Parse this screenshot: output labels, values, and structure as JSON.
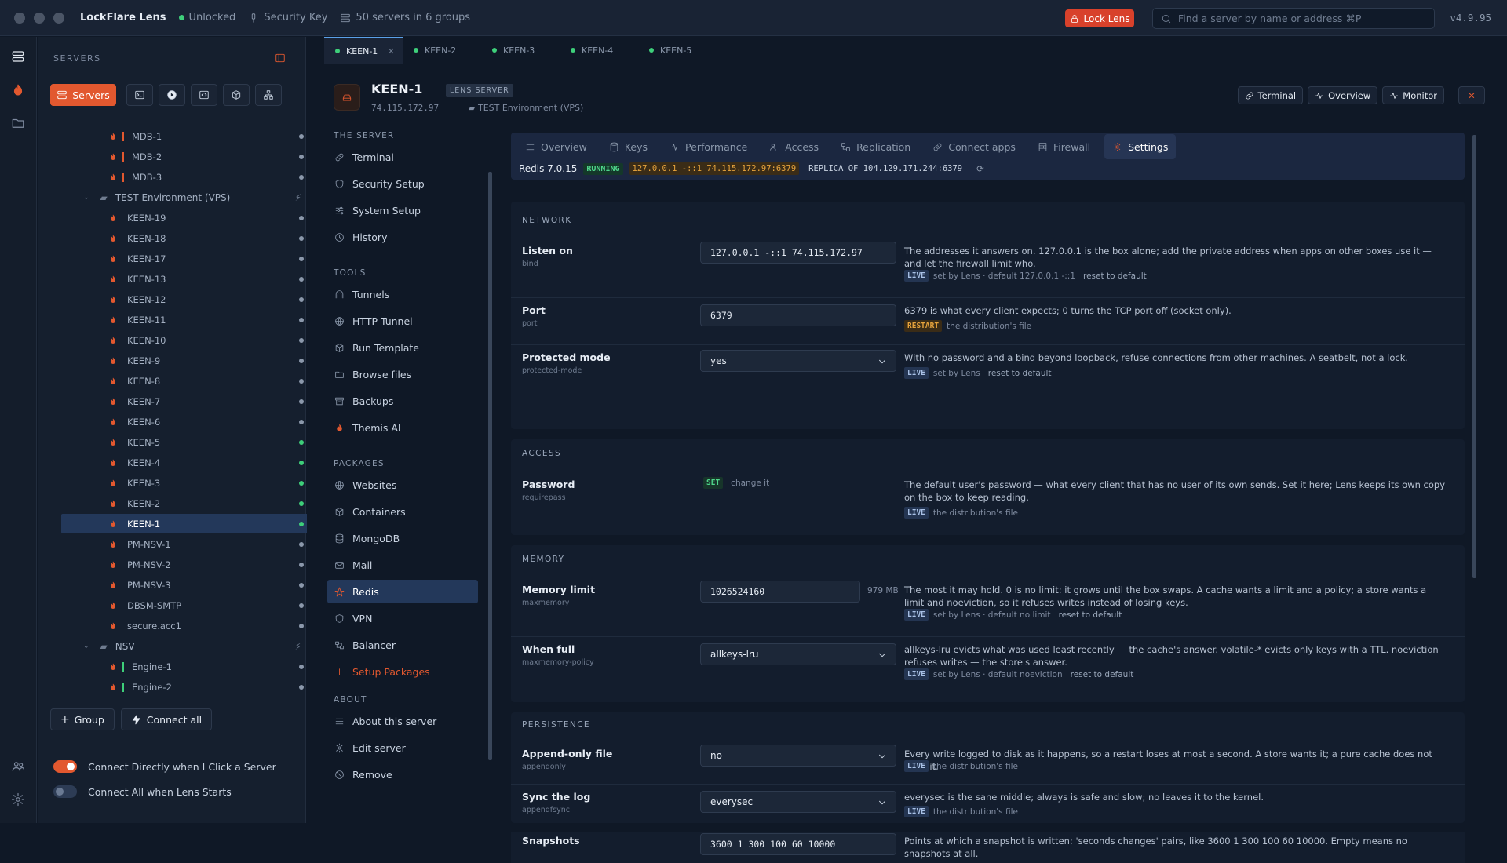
{
  "titlebar": {
    "app": "LockFlare Lens",
    "status": "Unlocked",
    "key": "Security Key",
    "servers": "50 servers in 6 groups",
    "lock": "Lock Lens",
    "search_placeholder": "Find a server by name or address ⌘P",
    "version": "v4.9.95"
  },
  "sidebar": {
    "title": "SERVERS",
    "servers_btn": "Servers",
    "tree": [
      {
        "kind": "server",
        "label": "MDB-1",
        "bar": "#e2582f",
        "dot": "#8b98ab"
      },
      {
        "kind": "server",
        "label": "MDB-2",
        "bar": "#e2582f",
        "dot": "#8b98ab"
      },
      {
        "kind": "server",
        "label": "MDB-3",
        "bar": "#e2582f",
        "dot": "#8b98ab"
      },
      {
        "kind": "group",
        "label": "TEST Environment (VPS)"
      },
      {
        "kind": "server",
        "label": "KEEN-19",
        "dot": "#8b98ab"
      },
      {
        "kind": "server",
        "label": "KEEN-18",
        "dot": "#8b98ab"
      },
      {
        "kind": "server",
        "label": "KEEN-17",
        "dot": "#8b98ab"
      },
      {
        "kind": "server",
        "label": "KEEN-13",
        "dot": "#8b98ab"
      },
      {
        "kind": "server",
        "label": "KEEN-12",
        "dot": "#8b98ab"
      },
      {
        "kind": "server",
        "label": "KEEN-11",
        "dot": "#8b98ab"
      },
      {
        "kind": "server",
        "label": "KEEN-10",
        "dot": "#8b98ab"
      },
      {
        "kind": "server",
        "label": "KEEN-9",
        "dot": "#8b98ab"
      },
      {
        "kind": "server",
        "label": "KEEN-8",
        "dot": "#8b98ab"
      },
      {
        "kind": "server",
        "label": "KEEN-7",
        "dot": "#8b98ab"
      },
      {
        "kind": "server",
        "label": "KEEN-6",
        "dot": "#8b98ab"
      },
      {
        "kind": "server",
        "label": "KEEN-5",
        "dot": "#3ecf7a"
      },
      {
        "kind": "server",
        "label": "KEEN-4",
        "dot": "#3ecf7a"
      },
      {
        "kind": "server",
        "label": "KEEN-3",
        "dot": "#3ecf7a"
      },
      {
        "kind": "server",
        "label": "KEEN-2",
        "dot": "#3ecf7a"
      },
      {
        "kind": "server",
        "label": "KEEN-1",
        "dot": "#3ecf7a",
        "selected": true
      },
      {
        "kind": "server",
        "label": "PM-NSV-1",
        "dot": "#8b98ab"
      },
      {
        "kind": "server",
        "label": "PM-NSV-2",
        "dot": "#8b98ab"
      },
      {
        "kind": "server",
        "label": "PM-NSV-3",
        "dot": "#8b98ab"
      },
      {
        "kind": "server",
        "label": "DBSM-SMTP",
        "dot": "#8b98ab"
      },
      {
        "kind": "server",
        "label": "secure.acc1",
        "dot": "#8b98ab"
      },
      {
        "kind": "group",
        "label": "NSV"
      },
      {
        "kind": "server",
        "label": "Engine-1",
        "bar": "#3ecf7a",
        "dot": "#8b98ab"
      },
      {
        "kind": "server",
        "label": "Engine-2",
        "bar": "#3ecf7a",
        "dot": "#8b98ab"
      }
    ],
    "group_btn": "Group",
    "connect_all_btn": "Connect all",
    "toggle1": "Connect Directly when I Click a Server",
    "toggle2": "Connect All when Lens Starts"
  },
  "tabs": [
    "KEEN-1",
    "KEEN-2",
    "KEEN-3",
    "KEEN-4",
    "KEEN-5"
  ],
  "server": {
    "name": "KEEN-1",
    "badge": "LENS SERVER",
    "address": "74.115.172.97",
    "env": "TEST Environment (VPS)"
  },
  "head_actions": {
    "terminal": "Terminal",
    "overview": "Overview",
    "monitor": "Monitor"
  },
  "nav": {
    "sec_server": "THE SERVER",
    "sec_tools": "TOOLS",
    "sec_packages": "PACKAGES",
    "sec_about": "ABOUT",
    "items": [
      {
        "label": "Terminal",
        "icon": "link-icon"
      },
      {
        "label": "Security Setup",
        "icon": "shield-icon"
      },
      {
        "label": "System Setup",
        "icon": "sliders-icon"
      },
      {
        "label": "History",
        "icon": "clock-icon"
      },
      {
        "label": "Tunnels",
        "icon": "tunnel-icon"
      },
      {
        "label": "HTTP Tunnel",
        "icon": "globe-icon"
      },
      {
        "label": "Run Template",
        "icon": "box-icon"
      },
      {
        "label": "Browse files",
        "icon": "folder-icon"
      },
      {
        "label": "Backups",
        "icon": "archive-icon"
      },
      {
        "label": "Themis AI",
        "icon": "flame-icon"
      },
      {
        "label": "Websites",
        "icon": "globe-icon"
      },
      {
        "label": "Containers",
        "icon": "box-icon"
      },
      {
        "label": "MongoDB",
        "icon": "database-icon"
      },
      {
        "label": "Mail",
        "icon": "mail-icon"
      },
      {
        "label": "Redis",
        "icon": "redis-icon"
      },
      {
        "label": "VPN",
        "icon": "shield-icon"
      },
      {
        "label": "Balancer",
        "icon": "balancer-icon"
      },
      {
        "label": "Setup Packages",
        "icon": "plus-icon"
      },
      {
        "label": "About this server",
        "icon": "list-icon"
      },
      {
        "label": "Edit server",
        "icon": "gear-icon"
      },
      {
        "label": "Remove",
        "icon": "ban-icon"
      }
    ]
  },
  "ptabs": [
    "Overview",
    "Keys",
    "Performance",
    "Access",
    "Replication",
    "Connect apps",
    "Firewall",
    "Settings"
  ],
  "status": {
    "version": "Redis 7.0.15",
    "state": "RUNNING",
    "bind": "127.0.0.1 -::1 74.115.172.97:6379",
    "replica": "REPLICA OF 104.129.171.244:6379"
  },
  "sections": {
    "network": "NETWORK",
    "access": "ACCESS",
    "memory": "MEMORY",
    "persistence": "PERSISTENCE"
  },
  "settings": {
    "bind": {
      "label": "Listen on",
      "key": "bind",
      "value": "127.0.0.1 -::1 74.115.172.97",
      "desc": "The addresses it answers on. 127.0.0.1 is the box alone; add the private address when apps on other boxes use it — and let the firewall limit who.",
      "badge": "LIVE",
      "meta": "set by Lens · default 127.0.0.1 -::1",
      "reset": "reset to default"
    },
    "port": {
      "label": "Port",
      "key": "port",
      "value": "6379",
      "desc": "6379 is what every client expects; 0 turns the TCP port off (socket only).",
      "badge": "RESTART",
      "meta": "the distribution's file"
    },
    "protected": {
      "label": "Protected mode",
      "key": "protected-mode",
      "value": "yes",
      "desc": "With no password and a bind beyond loopback, refuse connections from other machines. A seatbelt, not a lock.",
      "badge": "LIVE",
      "meta": "set by Lens",
      "reset": "reset to default"
    },
    "password": {
      "label": "Password",
      "key": "requirepass",
      "state": "SET",
      "change": "change it",
      "desc": "The default user's password — what every client that has no user of its own sends. Set it here; Lens keeps its own copy on the box to keep reading.",
      "badge": "LIVE",
      "meta": "the distribution's file"
    },
    "maxmemory": {
      "label": "Memory limit",
      "key": "maxmemory",
      "value": "1026524160",
      "unit": "979 MB",
      "desc": "The most it may hold. 0 is no limit: it grows until the box swaps. A cache wants a limit and a policy; a store wants a limit and noeviction, so it refuses writes instead of losing keys.",
      "badge": "LIVE",
      "meta": "set by Lens · default no limit",
      "reset": "reset to default"
    },
    "policy": {
      "label": "When full",
      "key": "maxmemory-policy",
      "value": "allkeys-lru",
      "desc": "allkeys-lru evicts what was used least recently — the cache's answer. volatile-* evicts only keys with a TTL. noeviction refuses writes — the store's answer.",
      "badge": "LIVE",
      "meta": "set by Lens · default noeviction",
      "reset": "reset to default"
    },
    "aof": {
      "label": "Append-only file",
      "key": "appendonly",
      "value": "no",
      "desc": "Every write logged to disk as it happens, so a restart loses at most a second. A store wants it; a pure cache does not need it.",
      "badge": "LIVE",
      "meta": "the distribution's file"
    },
    "fsync": {
      "label": "Sync the log",
      "key": "appendfsync",
      "value": "everysec",
      "desc": "everysec is the sane middle; always is safe and slow; no leaves it to the kernel.",
      "badge": "LIVE",
      "meta": "the distribution's file"
    },
    "snapshots": {
      "label": "Snapshots",
      "value": "3600 1 300 100 60 10000",
      "desc": "Points at which a snapshot is written: 'seconds changes' pairs, like 3600 1 300 100 60 10000. Empty means no snapshots at all."
    }
  }
}
